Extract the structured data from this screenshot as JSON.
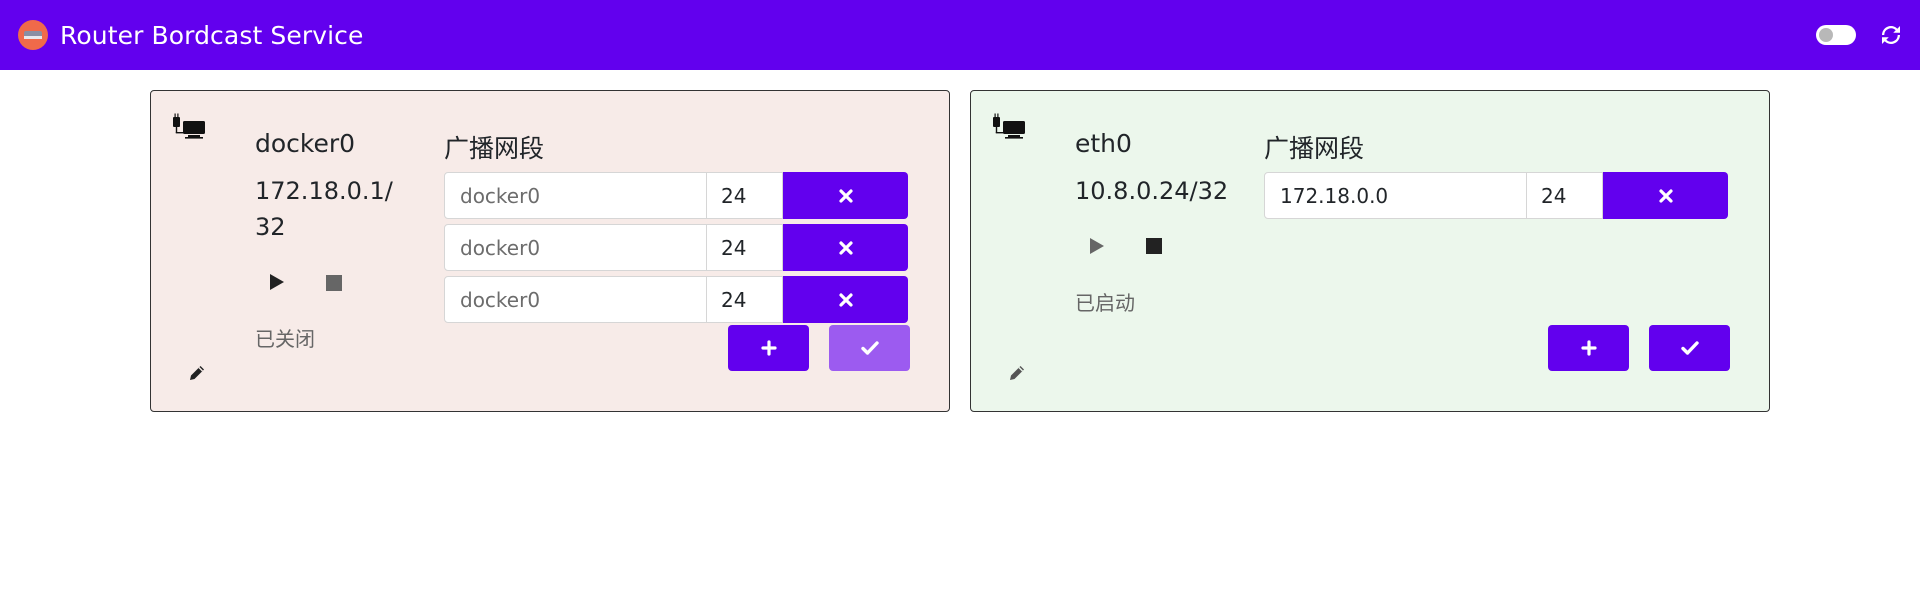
{
  "app": {
    "title": "Router Bordcast Service",
    "logo_icon": "router-logo-icon",
    "toggle_icon": "toggle-switch-icon",
    "refresh_icon": "refresh-icon",
    "accent_color": "#6200ee"
  },
  "cards": [
    {
      "background": "#f7ebe8",
      "state": "stopped",
      "icon": "network-interface-icon",
      "name": "docker0",
      "ip": "172.18.0.1/32",
      "status": "已关闭",
      "section_title": "广播网段",
      "rows": [
        {
          "network": "",
          "network_placeholder": "docker0",
          "mask": "24"
        },
        {
          "network": "",
          "network_placeholder": "docker0",
          "mask": "24"
        },
        {
          "network": "",
          "network_placeholder": "docker0",
          "mask": "24"
        }
      ],
      "confirm_enabled": false
    },
    {
      "background": "#ecf7ec",
      "state": "running",
      "icon": "network-interface-icon",
      "name": "eth0",
      "ip": "10.8.0.24/32",
      "status": "已启动",
      "section_title": "广播网段",
      "rows": [
        {
          "network": "172.18.0.0",
          "network_placeholder": "",
          "mask": "24"
        }
      ],
      "confirm_enabled": true
    }
  ]
}
